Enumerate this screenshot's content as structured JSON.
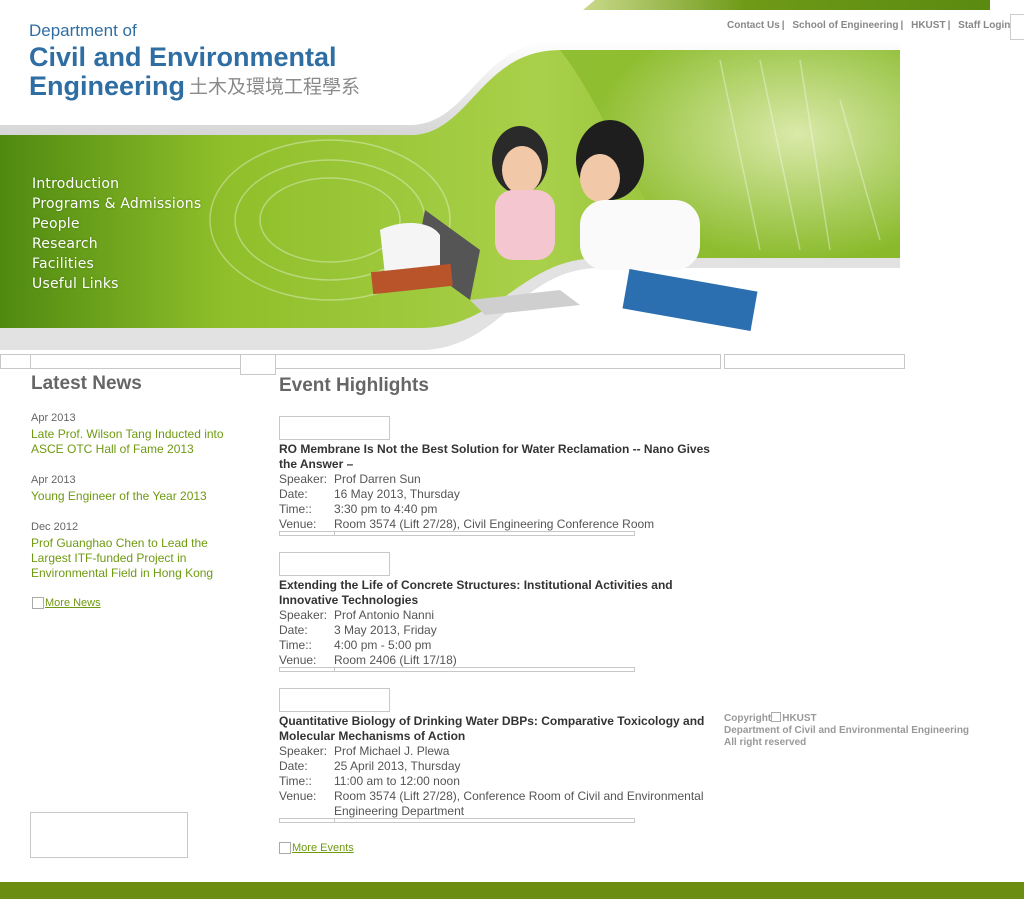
{
  "header": {
    "dept_line": "Department of",
    "name_line1": "Civil and Environmental",
    "name_line2": "Engineering",
    "chinese_name": "土木及環境工程學系",
    "links": [
      "Contact Us",
      "School of Engineering",
      "HKUST",
      "Staff Login"
    ]
  },
  "nav": {
    "items": [
      "Introduction",
      "Programs & Admissions",
      "People",
      "Research",
      "Facilities",
      "Useful Links"
    ]
  },
  "latest_news": {
    "heading": "Latest News",
    "items": [
      {
        "date": "Apr 2013",
        "title": "Late Prof. Wilson Tang Inducted into ASCE OTC Hall of Fame 2013"
      },
      {
        "date": "Apr 2013",
        "title": "Young Engineer of the Year 2013"
      },
      {
        "date": "Dec 2012",
        "title": "Prof Guanghao Chen to Lead the Largest ITF-funded Project in Environmental Field in Hong Kong"
      }
    ],
    "more_label": "More News"
  },
  "events": {
    "heading": "Event Highlights",
    "labels": {
      "speaker": "Speaker:",
      "date": "Date:",
      "time": "Time::",
      "venue": "Venue:"
    },
    "items": [
      {
        "title": "RO Membrane Is Not the Best Solution for Water Reclamation -- Nano Gives the Answer –",
        "speaker": "Prof Darren Sun",
        "date": "16 May 2013, Thursday",
        "time": "3:30 pm to 4:40 pm",
        "venue": "Room 3574 (Lift 27/28), Civil Engineering Conference Room"
      },
      {
        "title": "Extending the Life of Concrete Structures: Institutional Activities and Innovative Technologies",
        "speaker": "Prof Antonio Nanni",
        "date": "3 May 2013, Friday",
        "time": "4:00 pm - 5:00 pm",
        "venue": "Room 2406 (Lift 17/18)"
      },
      {
        "title": "Quantitative Biology of Drinking Water DBPs: Comparative Toxicology and Molecular Mechanisms of Action",
        "speaker": "Prof Michael J. Plewa",
        "date": "25 April 2013, Thursday",
        "time": "11:00 am to 12:00 noon",
        "venue": "Room 3574 (Lift 27/28), Conference Room of Civil and Environmental Engineering Department"
      }
    ],
    "more_label": "More Events"
  },
  "footer": {
    "copyright_label": "Copyright",
    "copyright_org": "HKUST",
    "dept": "Department of Civil and Environmental Engineering",
    "rights": "All right reserved"
  },
  "colors": {
    "brand_blue": "#2f6ea3",
    "brand_green": "#6b8e12",
    "link_green": "#6f9a10"
  }
}
